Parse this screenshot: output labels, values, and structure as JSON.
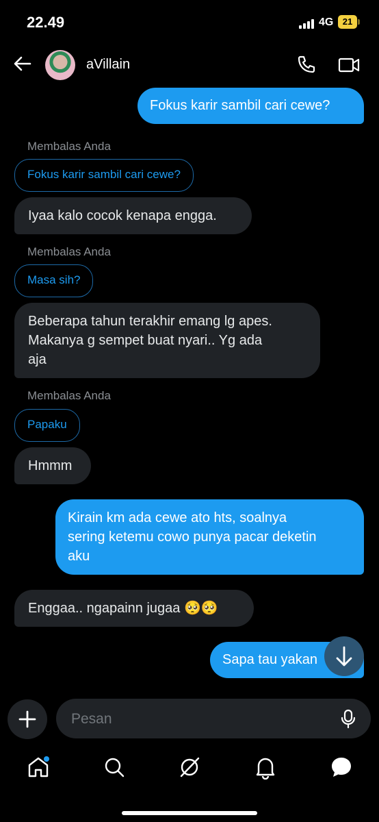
{
  "status_bar": {
    "time": "22.49",
    "network": "4G",
    "battery": "21"
  },
  "header": {
    "contact_name": "aVillain"
  },
  "messages": [
    {
      "text": "Fokus karir sambil cari cewe?"
    },
    {
      "reply_label": "Membalas Anda",
      "quote": "Fokus karir sambil cari cewe?",
      "text": "Iyaa kalo cocok kenapa engga."
    },
    {
      "reply_label": "Membalas Anda",
      "quote": "Masa sih?",
      "text_lines": [
        "Beberapa tahun terakhir emang lg apes.",
        "Makanya g sempet buat nyari.. Yg ada",
        "aja"
      ]
    },
    {
      "reply_label": "Membalas Anda",
      "quote": "Papaku",
      "text": "Hmmm"
    },
    {
      "text_lines": [
        "Kirain km ada cewe ato hts, soalnya",
        "sering ketemu cowo punya pacar deketin",
        "aku"
      ]
    },
    {
      "text": "Enggaa.. ngapainn jugaa 🥺🥺"
    },
    {
      "text": "Sapa tau yakan"
    }
  ],
  "composer": {
    "placeholder": "Pesan"
  },
  "colors": {
    "accent": "#1d9bf0",
    "incoming_bubble": "#202327",
    "background": "#000000"
  }
}
